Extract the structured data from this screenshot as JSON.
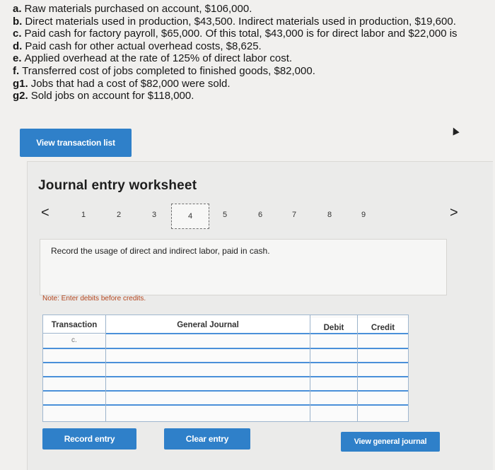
{
  "transactions": [
    {
      "key": "a.",
      "text": "Raw materials purchased on account, $106,000."
    },
    {
      "key": "b.",
      "text": "Direct materials used in production, $43,500. Indirect materials used in production, $19,600."
    },
    {
      "key": "c.",
      "text": "Paid cash for factory payroll, $65,000. Of this total, $43,000 is for direct labor and $22,000 is"
    },
    {
      "key": "d.",
      "text": "Paid cash for other actual overhead costs, $8,625."
    },
    {
      "key": "e.",
      "text": "Applied overhead at the rate of 125% of direct labor cost."
    },
    {
      "key": "f.",
      "text": "Transferred cost of jobs completed to finished goods, $82,000."
    },
    {
      "key": "g1.",
      "text": "Jobs that had a cost of $82,000 were sold."
    },
    {
      "key": "g2.",
      "text": "Sold jobs on account for $118,000."
    }
  ],
  "buttons": {
    "view_transaction_list": "View transaction list",
    "record_entry": "Record entry",
    "clear_entry": "Clear entry",
    "view_general_journal": "View general journal"
  },
  "worksheet": {
    "title": "Journal entry worksheet",
    "prev": "<",
    "next": ">",
    "pages": [
      "1",
      "2",
      "3",
      "4",
      "5",
      "6",
      "7",
      "8",
      "9"
    ],
    "current_page": "4",
    "instruction": "Record the usage of direct and indirect labor, paid in cash.",
    "note": "Note: Enter debits before credits."
  },
  "journal": {
    "headers": {
      "transaction": "Transaction",
      "general_journal": "General Journal",
      "debit": "Debit",
      "credit": "Credit"
    },
    "transaction_label": "c."
  },
  "colors": {
    "accent": "#2f80c9",
    "note": "#b4461e",
    "grid_line": "#4a90d9"
  }
}
